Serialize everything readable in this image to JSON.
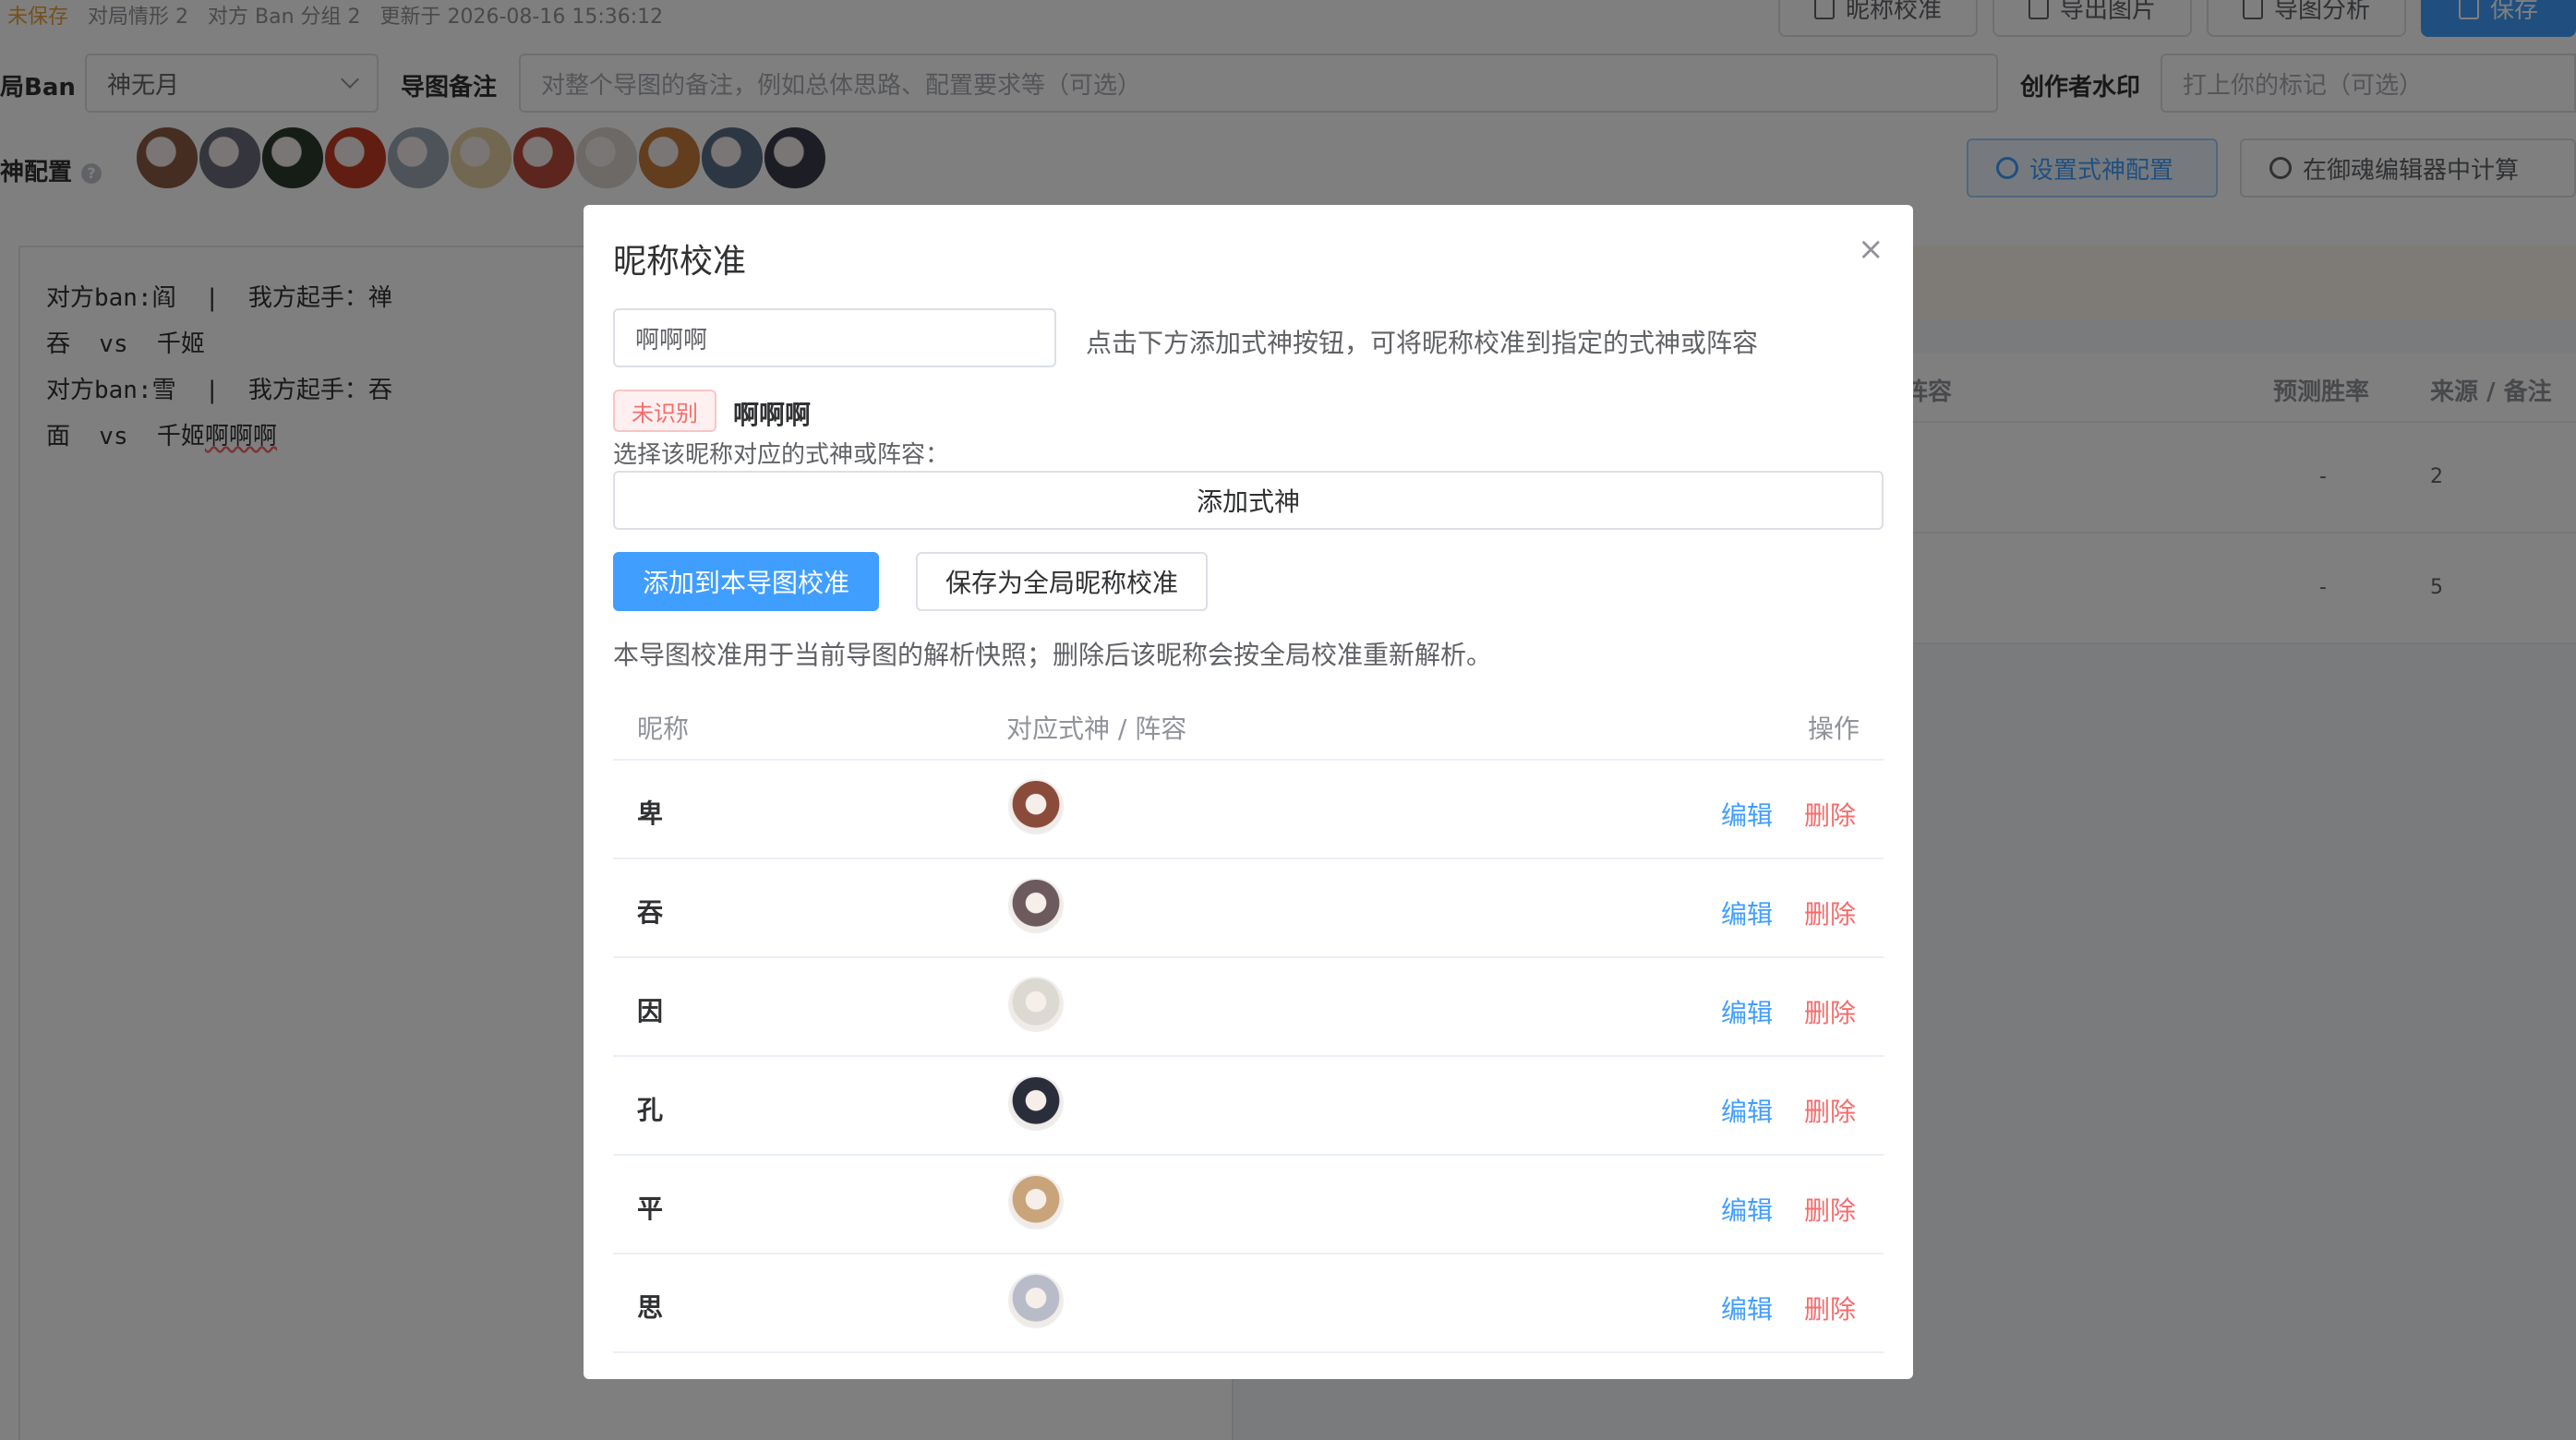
{
  "status_bar": {
    "unsaved": "未保存",
    "situations": "对局情形 2",
    "ban_groups": "对方 Ban 分组 2",
    "updated": "更新于 2026-08-16 15:36:12"
  },
  "toolbar": {
    "calibrate_label": "昵称校准",
    "export_label": "导出图片",
    "analysis_label": "导图分析",
    "save_label": "保存"
  },
  "form": {
    "ban_label": "局Ban",
    "ban_value": "神无月",
    "note_label": "导图备注",
    "note_placeholder": "对整个导图的备注，例如总体思路、配置要求等（可选）",
    "watermark_label": "创作者水印",
    "watermark_placeholder": "打上你的标记（可选）",
    "config_label": "神配置",
    "set_config_label": "设置式神配置",
    "calc_label": "在御魂编辑器中计算",
    "avatar_colors": [
      "#8a5a44",
      "#6b6b7a",
      "#2d3a2e",
      "#c23b22",
      "#9aa6b2",
      "#e5cfa0",
      "#b84a3c",
      "#d8d2cf",
      "#c57a3c",
      "#5b6f86",
      "#3b3b4a"
    ]
  },
  "editor": {
    "lines": [
      "对方ban:阎  |  我方起手：禅",
      "吞  vs  千姬",
      "",
      "对方ban:雪  |  我方起手：吞",
      "面  vs  千姬"
    ],
    "typed": "啊啊啊"
  },
  "bg_table": {
    "col_lineup": "阵容",
    "col_winrate": "预测胜率",
    "col_source": "来源 / 备注",
    "rows": [
      {
        "winrate": "-",
        "source": "2"
      },
      {
        "winrate": "-",
        "source": "5"
      }
    ]
  },
  "dialog": {
    "title": "昵称校准",
    "input_value": "啊啊啊",
    "hint": "点击下方添加式神按钮，可将昵称校准到指定的式神或阵容",
    "tag": "未识别",
    "unrecognized_name": "啊啊啊",
    "choose_label": "选择该昵称对应的式神或阵容：",
    "add_shishen": "添加式神",
    "btn_add_local": "添加到本导图校准",
    "btn_save_global": "保存为全局昵称校准",
    "note": "本导图校准用于当前导图的解析快照；删除后该昵称会按全局校准重新解析。",
    "columns": {
      "nick": "昵称",
      "target": "对应式神 / 阵容",
      "action": "操作"
    },
    "edit_label": "编辑",
    "delete_label": "删除",
    "rows": [
      {
        "nick": "卑",
        "color": "#8a4b3a"
      },
      {
        "nick": "吞",
        "color": "#6d5a5e"
      },
      {
        "nick": "因",
        "color": "#dcd8d2"
      },
      {
        "nick": "孔",
        "color": "#2a2d3a"
      },
      {
        "nick": "平",
        "color": "#c9a37a"
      },
      {
        "nick": "思",
        "color": "#b8bcc8"
      }
    ]
  }
}
